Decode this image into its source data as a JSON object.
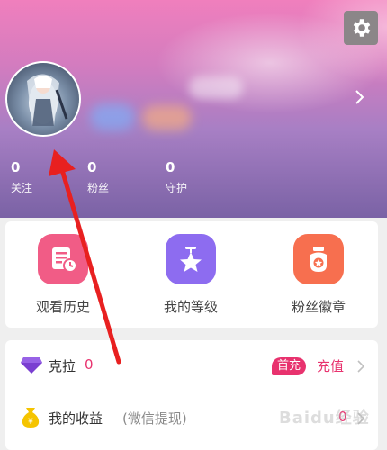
{
  "profile": {
    "stats": [
      {
        "value": "0",
        "label": "关注"
      },
      {
        "value": "0",
        "label": "粉丝"
      },
      {
        "value": "0",
        "label": "守护"
      }
    ]
  },
  "tiles": [
    {
      "label": "观看历史",
      "icon": "history-icon",
      "color": "#f15c86"
    },
    {
      "label": "我的等级",
      "icon": "star-level-icon",
      "color": "#8d6cf0"
    },
    {
      "label": "粉丝徽章",
      "icon": "fan-badge-icon",
      "color": "#f76f4f"
    }
  ],
  "wallet": {
    "carat_label": "克拉",
    "carat_value": "0",
    "first_recharge_badge": "首充",
    "recharge_label": "充值",
    "earnings_label": "我的收益",
    "earnings_note": "(微信提现)",
    "earnings_value": "0"
  },
  "watermark": "Baidu经验",
  "colors": {
    "accent": "#e8326e",
    "arrow": "#e82020"
  }
}
